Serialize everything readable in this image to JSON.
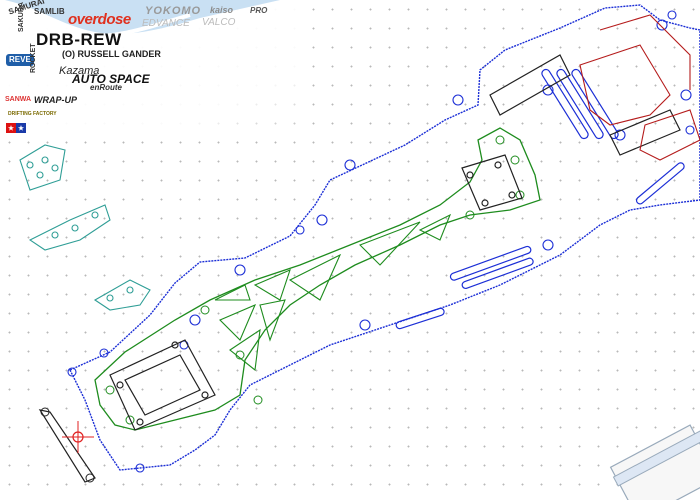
{
  "cad": {
    "title": "DRB-REW",
    "driver": "(O) RUSSELL GANDER",
    "sponsors": [
      "SAMURAI",
      "SAMLIB",
      "overdose",
      "YOKOMO",
      "kaiso",
      "EDVANCE",
      "VALCO",
      "PRO",
      "REVE",
      "SANWA",
      "WRAP-UP",
      "DRIFTING FACTORY",
      "Kazama",
      "AUTO SPACE",
      "enRoute",
      "ROCKET",
      "SAKURA"
    ],
    "colors": {
      "chassis_outline": "#1c2fd6",
      "main_plate": "#1e8c1e",
      "rear_component": "#b51c1c",
      "mounts": "#222222",
      "small_parts": "#2f9e96",
      "red_marker": "#e02020",
      "grid_dot": "#b8b8b8"
    }
  }
}
